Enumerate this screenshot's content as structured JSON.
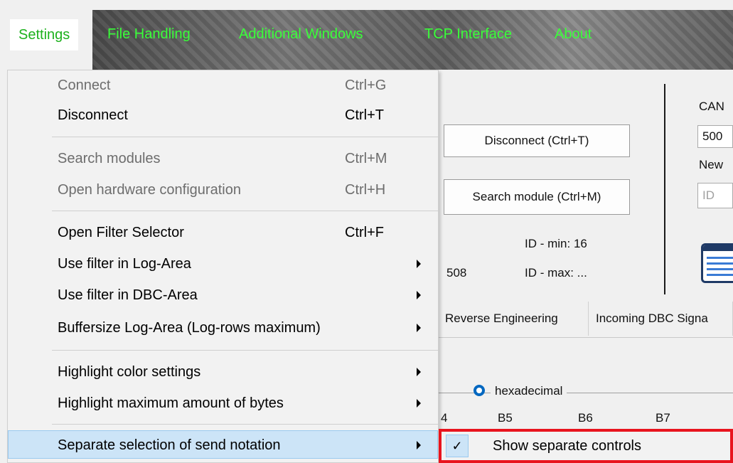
{
  "menubar": {
    "items": [
      {
        "label": "Settings"
      },
      {
        "label": "File Handling"
      },
      {
        "label": "Additional Windows"
      },
      {
        "label": "TCP Interface"
      },
      {
        "label": "About"
      }
    ]
  },
  "background": {
    "disconnect_button": "Disconnect (Ctrl+T)",
    "search_module_button": "Search module (Ctrl+M)",
    "can_label": "CAN",
    "baud_value": "500",
    "new_label": "New",
    "id_placeholder": "ID",
    "id_min": "ID - min: 16",
    "id_max": "ID - max: ...",
    "partial_number": "508",
    "tabs": [
      {
        "label": "Reverse Engineering"
      },
      {
        "label": "Incoming DBC Signa"
      }
    ],
    "hex_label": "hexadecimal",
    "byte_cols": [
      "4",
      "B5",
      "B6",
      "B7"
    ]
  },
  "dropdown": {
    "items": [
      {
        "label": "Connect",
        "shortcut": "Ctrl+G"
      },
      {
        "label": "Disconnect",
        "shortcut": "Ctrl+T"
      },
      {
        "label": "Search modules",
        "shortcut": "Ctrl+M"
      },
      {
        "label": "Open hardware configuration",
        "shortcut": "Ctrl+H"
      },
      {
        "label": "Open Filter Selector",
        "shortcut": "Ctrl+F"
      },
      {
        "label": "Use filter in Log-Area"
      },
      {
        "label": "Use filter in DBC-Area"
      },
      {
        "label": "Buffersize Log-Area (Log-rows maximum)"
      },
      {
        "label": "Highlight color settings"
      },
      {
        "label": "Highlight maximum amount of bytes"
      },
      {
        "label": "Separate selection of send notation"
      }
    ]
  },
  "submenu": {
    "check_glyph": "✓",
    "label": "Show separate controls"
  }
}
